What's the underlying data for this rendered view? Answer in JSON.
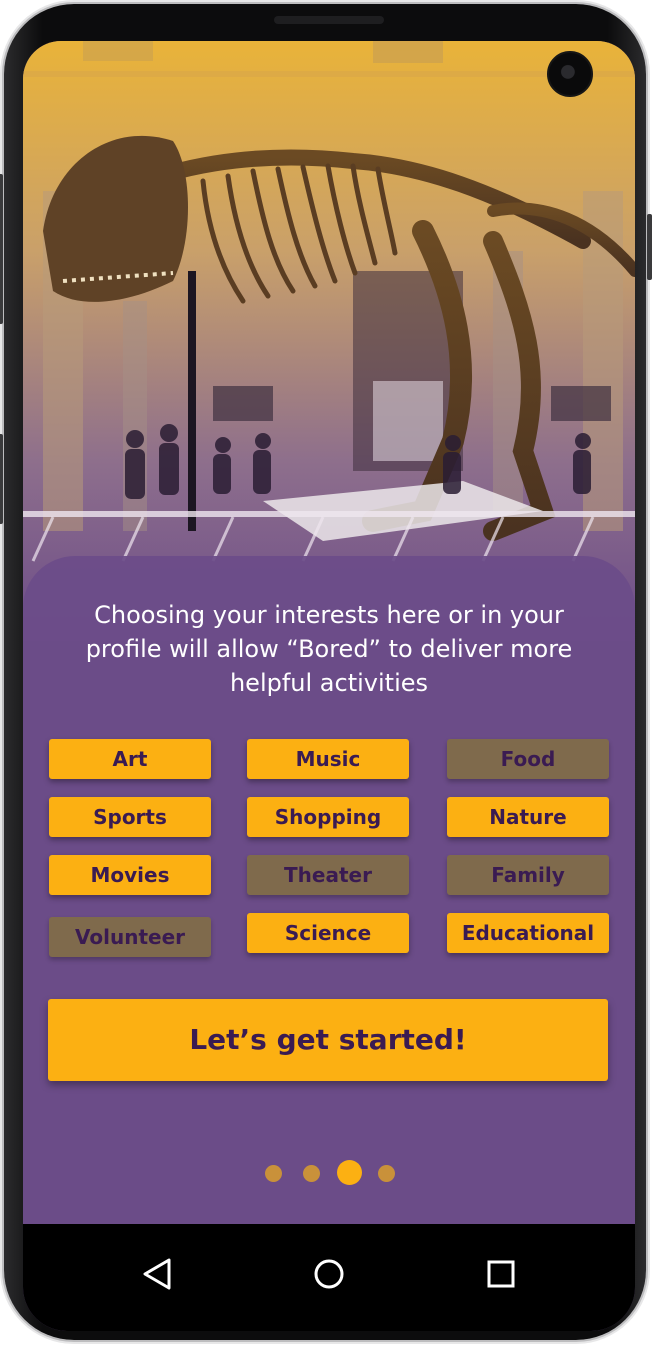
{
  "intro_text": "Choosing your interests here or in your profile will allow “Bored” to deliver more helpful activities",
  "interests": [
    {
      "label": "Art",
      "selected": true
    },
    {
      "label": "Music",
      "selected": true
    },
    {
      "label": "Food",
      "selected": false
    },
    {
      "label": "Sports",
      "selected": true
    },
    {
      "label": "Shopping",
      "selected": true
    },
    {
      "label": "Nature",
      "selected": true
    },
    {
      "label": "Movies",
      "selected": true
    },
    {
      "label": "Theater",
      "selected": false
    },
    {
      "label": "Family",
      "selected": false
    },
    {
      "label": "Volunteer",
      "selected": false
    },
    {
      "label": "Science",
      "selected": true
    },
    {
      "label": "Educational",
      "selected": true
    }
  ],
  "cta_label": "Let’s get started!",
  "pager": {
    "count": 4,
    "active_index": 2
  },
  "colors": {
    "accent": "#fcb012",
    "panel": "#6c4c89",
    "chip_text": "#3a1b52",
    "chip_unselected": "#7f6a4c",
    "dot_inactive": "#c9913a"
  },
  "nav_icons": [
    "back-triangle-icon",
    "home-circle-icon",
    "recents-square-icon"
  ]
}
